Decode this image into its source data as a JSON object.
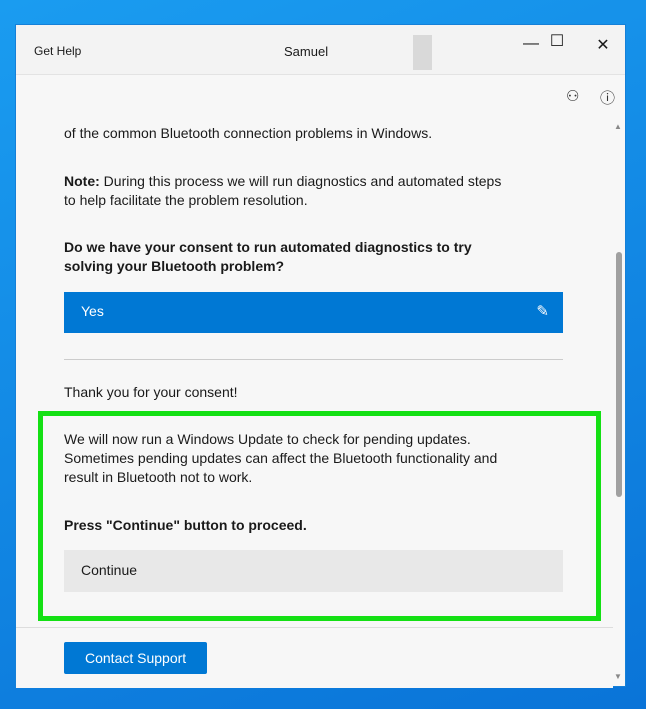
{
  "window": {
    "app_title": "Get Help",
    "user_name": "Samuel"
  },
  "content": {
    "intro_partial": "of the common Bluetooth connection problems in Windows.",
    "note_label": "Note:",
    "note_text": " During this process we will run diagnostics and automated steps to help facilitate the problem resolution.",
    "question": "Do we have your consent to run automated diagnostics to try solving your Bluetooth problem?",
    "answer": "Yes",
    "thanks": "Thank you for your consent!",
    "update_text": "We will now run a Windows Update to check for pending updates. Sometimes pending updates can affect the Bluetooth functionality and result in Bluetooth not to work.",
    "proceed": "Press \"Continue\" button to proceed.",
    "continue_label": "Continue"
  },
  "footer": {
    "contact_label": "Contact Support"
  }
}
